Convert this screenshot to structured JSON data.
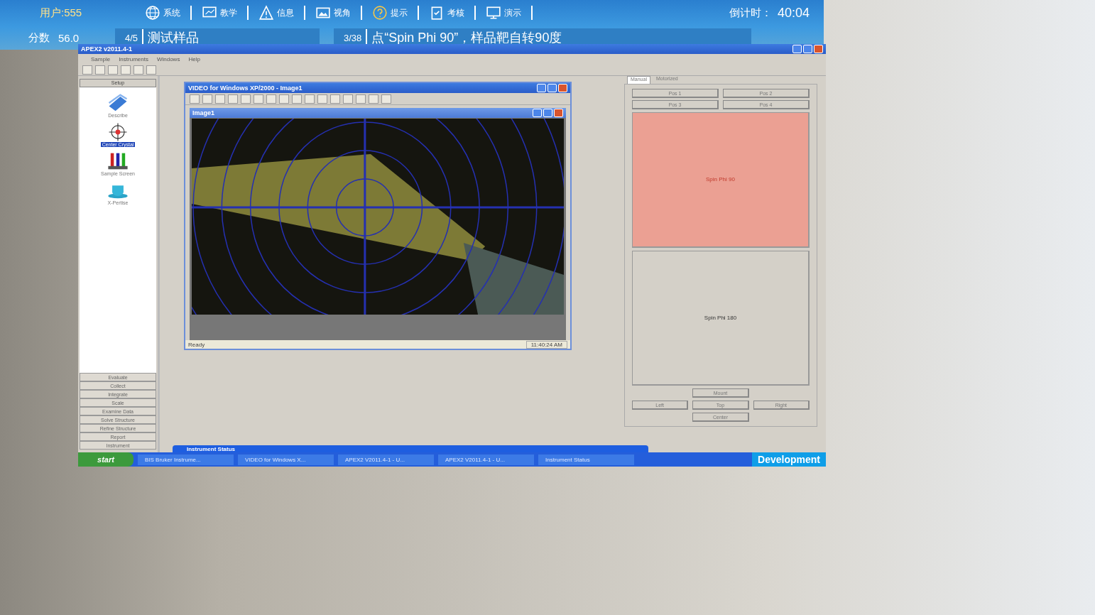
{
  "hud": {
    "user": "用户:555",
    "score_label": "分数",
    "score": "56.0",
    "countdown_label": "倒计时：",
    "countdown": "40:04",
    "nav": [
      {
        "kind": "globe",
        "label": "系统"
      },
      {
        "kind": "teach",
        "label": "教学"
      },
      {
        "kind": "warning",
        "label": "信息"
      },
      {
        "kind": "picture",
        "label": "视角"
      },
      {
        "kind": "help",
        "label": "提示"
      },
      {
        "kind": "clipboard",
        "label": "考核"
      },
      {
        "kind": "monitor",
        "label": "演示"
      }
    ],
    "step": {
      "index": "4",
      "total": "/5",
      "title": "测试样品"
    },
    "task": {
      "index": "3",
      "total": "/38",
      "text": "点“Spin Phi 90”，样品靶自转90度"
    }
  },
  "app": {
    "title": "APEX2 v2011.4-1",
    "menu": [
      "Sample",
      "Instruments",
      "Windows",
      "Help"
    ],
    "sidebar": {
      "header": "Setup",
      "tools": [
        {
          "kind": "describe",
          "label": "Describe",
          "selected": false
        },
        {
          "kind": "crosshair",
          "label": "Center Crystal",
          "selected": true
        },
        {
          "kind": "tubes",
          "label": "Sample Screen",
          "selected": false
        },
        {
          "kind": "cup",
          "label": "X-Pertise",
          "selected": false
        }
      ],
      "stages": [
        "Evaluate",
        "Collect",
        "Integrate",
        "Scale",
        "Examine Data",
        "Solve Structure",
        "Refine Structure",
        "Report",
        "Instrument"
      ]
    },
    "video_window": {
      "title": "VIDEO for Windows XP/2000 - Image1",
      "child_title": "Image1",
      "status": "Ready",
      "status_time": "11:40:24 AM"
    },
    "panel": {
      "tabs": [
        {
          "label": "Manual",
          "selected": true
        },
        {
          "label": "Motorized",
          "selected": false
        }
      ],
      "positions": [
        "Pos 1",
        "Pos 2",
        "Pos 3",
        "Pos 4"
      ],
      "spin_buttons": [
        {
          "label": "Spin Phi 90",
          "highlighted": true
        },
        {
          "label": "Spin Phi 180",
          "highlighted": false
        }
      ],
      "mount": "Mount",
      "moves": [
        "Left",
        "Top",
        "Right"
      ],
      "center": "Center"
    }
  },
  "taskbar": {
    "start": "start",
    "popup": "Instrument Status",
    "tasks": [
      "BIS Bruker Instrume...",
      "VIDEO for Windows X...",
      "APEX2 V2011.4-1 - U...",
      "APEX2 V2011.4-1 - U...",
      "Instrument Status"
    ],
    "tray": "Development"
  }
}
